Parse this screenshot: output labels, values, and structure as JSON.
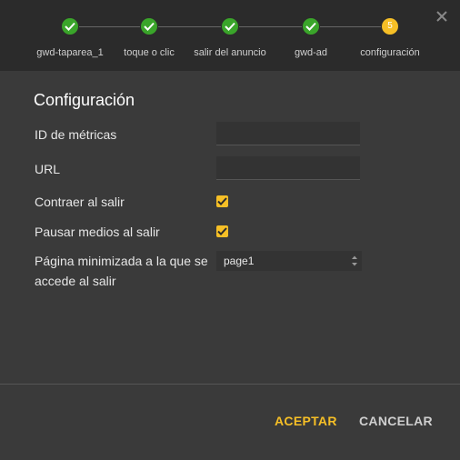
{
  "steps": [
    {
      "label": "gwd-taparea_1",
      "state": "done"
    },
    {
      "label": "toque o clic",
      "state": "done"
    },
    {
      "label": "salir del anuncio",
      "state": "done"
    },
    {
      "label": "gwd-ad",
      "state": "done"
    },
    {
      "label": "configuración",
      "state": "current",
      "number": "5"
    }
  ],
  "form": {
    "title": "Configuración",
    "metrics_id_label": "ID de métricas",
    "metrics_id_value": "",
    "url_label": "URL",
    "url_value": "",
    "collapse_label": "Contraer al salir",
    "collapse_checked": true,
    "pause_media_label": "Pausar medios al salir",
    "pause_media_checked": true,
    "minimized_page_label_line1": "Página minimizada a la que se",
    "minimized_page_label_line2": "accede al salir",
    "minimized_page_value": "page1"
  },
  "footer": {
    "accept_label": "ACEPTAR",
    "cancel_label": "CANCELAR"
  },
  "colors": {
    "accent": "#f6bf26",
    "done": "#3aa52a"
  }
}
